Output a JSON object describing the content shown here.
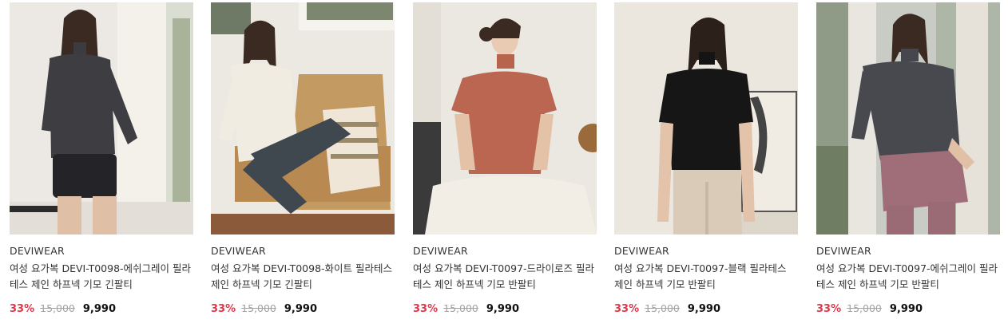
{
  "products": [
    {
      "brand": "DEVIWEAR",
      "name": "여성 요가복 DEVI-T0098-에쉬그레이 필라테스 제인 하프넥 기모 긴팔티",
      "discount": "33%",
      "original_price": "15,000",
      "sale_price": "9,990",
      "image_alt": "charcoal long-sleeve turtleneck with black shorts"
    },
    {
      "brand": "DEVIWEAR",
      "name": "여성 요가복 DEVI-T0098-화이트 필라테스 제인 하프넥 기모 긴팔티",
      "discount": "33%",
      "original_price": "15,000",
      "sale_price": "9,990",
      "image_alt": "white long-sleeve turtleneck seated on rattan chair"
    },
    {
      "brand": "DEVIWEAR",
      "name": "여성 요가복 DEVI-T0097-드라이로즈 필라테스 제인 하프넥 기모 반팔티",
      "discount": "33%",
      "original_price": "15,000",
      "sale_price": "9,990",
      "image_alt": "dry rose short-sleeve mock neck top"
    },
    {
      "brand": "DEVIWEAR",
      "name": "여성 요가복 DEVI-T0097-블랙 필라테스 제인 하프넥 기모 반팔티",
      "discount": "33%",
      "original_price": "15,000",
      "sale_price": "9,990",
      "image_alt": "black short-sleeve mock neck top"
    },
    {
      "brand": "DEVIWEAR",
      "name": "여성 요가복 DEVI-T0097-에쉬그레이 필라테스 제인 하프넥 기모 반팔티",
      "discount": "33%",
      "original_price": "15,000",
      "sale_price": "9,990",
      "image_alt": "ash grey short-sleeve mock neck top with skirt"
    }
  ],
  "colors": {
    "discount": "#e2374a",
    "original_price": "#a3a3a3",
    "sale_price": "#111111",
    "text": "#333333"
  }
}
